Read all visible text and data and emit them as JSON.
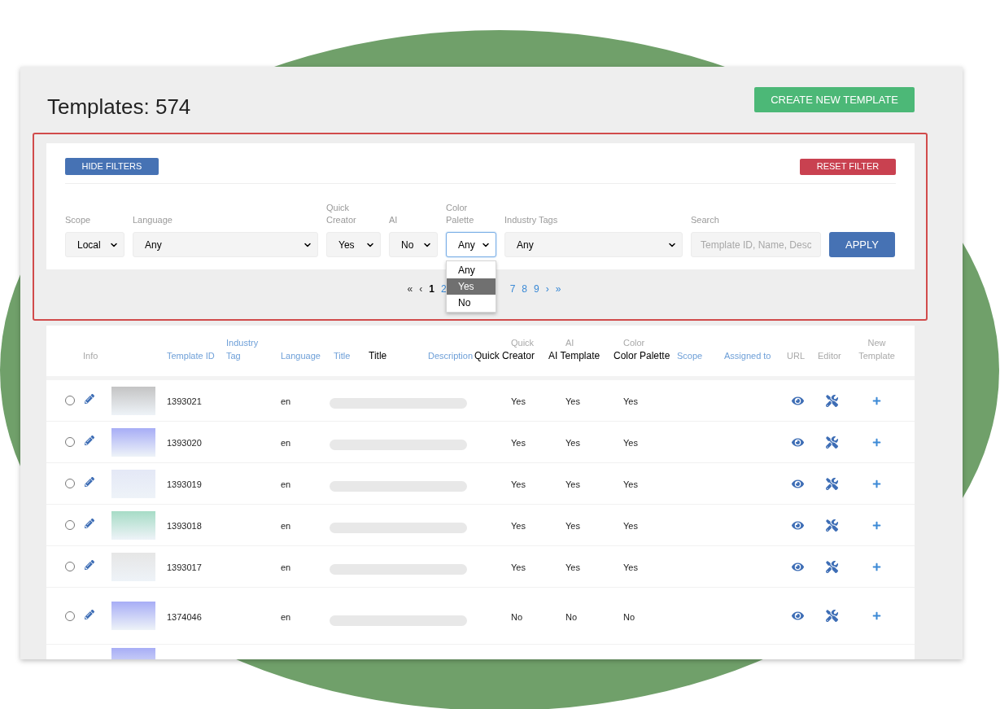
{
  "title": "Templates: 574",
  "create_button": "CREATE NEW TEMPLATE",
  "filters_panel": {
    "hide_button": "HIDE FILTERS",
    "reset_button": "RESET FILTER",
    "filters": [
      {
        "kind": "select",
        "label": "Scope",
        "value": "Local",
        "focused": false
      },
      {
        "kind": "select",
        "label": "Language",
        "value": "Any",
        "focused": false
      },
      {
        "kind": "select",
        "label": "Quick Creator",
        "value": "Yes",
        "focused": false
      },
      {
        "kind": "select",
        "label": "AI",
        "value": "No",
        "focused": false
      },
      {
        "kind": "select",
        "label": "Color Palette",
        "value": "Any",
        "focused": true,
        "options": [
          {
            "label": "Any",
            "highlighted": false
          },
          {
            "label": "Yes",
            "highlighted": true
          },
          {
            "label": "No",
            "highlighted": false
          }
        ]
      },
      {
        "kind": "select",
        "label": "Industry Tags",
        "value": "Any",
        "focused": false
      },
      {
        "kind": "search",
        "label": "Search",
        "placeholder": "Template ID, Name, Desc"
      }
    ],
    "apply_button": "APPLY"
  },
  "pagination": {
    "before": [
      {
        "label": "«",
        "selected": false,
        "disabled": true
      },
      {
        "label": "‹",
        "selected": false,
        "disabled": true
      },
      {
        "label": "1",
        "selected": true,
        "disabled": false
      },
      {
        "label": "2",
        "selected": false,
        "disabled": false
      }
    ],
    "after": [
      {
        "label": "7",
        "selected": false,
        "disabled": false
      },
      {
        "label": "8",
        "selected": false,
        "disabled": false
      },
      {
        "label": "9",
        "selected": false,
        "disabled": false
      },
      {
        "label": "›",
        "selected": false,
        "disabled": false
      },
      {
        "label": "»",
        "selected": false,
        "disabled": false
      }
    ]
  },
  "table": {
    "columns": [
      {
        "label": "Info",
        "sortable": false
      },
      {
        "label": "Template ID",
        "sortable": true
      },
      {
        "label": "Industry Tag",
        "sortable": true
      },
      {
        "label": "Language",
        "sortable": true
      },
      {
        "label": "Title",
        "sortable": true
      },
      {
        "overlay": "Title",
        "sortable": false
      },
      {
        "label": "Description",
        "sortable": true
      },
      {
        "label": "Quick",
        "overlay": "Quick Creator",
        "sortable": false
      },
      {
        "label": "AI",
        "overlay": "AI Template",
        "sortable": false
      },
      {
        "label": "Color",
        "overlay": "Color Palette",
        "sortable": false
      },
      {
        "label": "Scope",
        "sortable": true
      },
      {
        "label": "Assigned to",
        "sortable": true
      },
      {
        "label": "URL",
        "sortable": false
      },
      {
        "label": "Editor",
        "sortable": false
      },
      {
        "label": "New Template",
        "sortable": false
      }
    ],
    "rows": [
      {
        "kind": "full",
        "checked": false,
        "color": "#c4c4c4",
        "id": "1393021",
        "language": "en",
        "quick_creator": "Yes",
        "ai_template": "Yes",
        "color_palette": "Yes"
      },
      {
        "kind": "full",
        "checked": false,
        "color": "#a7adf6",
        "id": "1393020",
        "language": "en",
        "quick_creator": "Yes",
        "ai_template": "Yes",
        "color_palette": "Yes"
      },
      {
        "kind": "full",
        "checked": false,
        "color": "#e4e8f6",
        "id": "1393019",
        "language": "en",
        "quick_creator": "Yes",
        "ai_template": "Yes",
        "color_palette": "Yes"
      },
      {
        "kind": "full",
        "checked": false,
        "color": "#a6dcc6",
        "id": "1393018",
        "language": "en",
        "quick_creator": "Yes",
        "ai_template": "Yes",
        "color_palette": "Yes"
      },
      {
        "kind": "full",
        "checked": false,
        "color": "#e6e6e6",
        "id": "1393017",
        "language": "en",
        "quick_creator": "Yes",
        "ai_template": "Yes",
        "color_palette": "Yes"
      },
      {
        "kind": "tall",
        "checked": false,
        "color": "#a7adf6",
        "id": "1374046",
        "language": "en",
        "quick_creator": "No",
        "ai_template": "No",
        "color_palette": "No"
      },
      {
        "kind": "partial",
        "color": "#a7adf6"
      }
    ]
  }
}
